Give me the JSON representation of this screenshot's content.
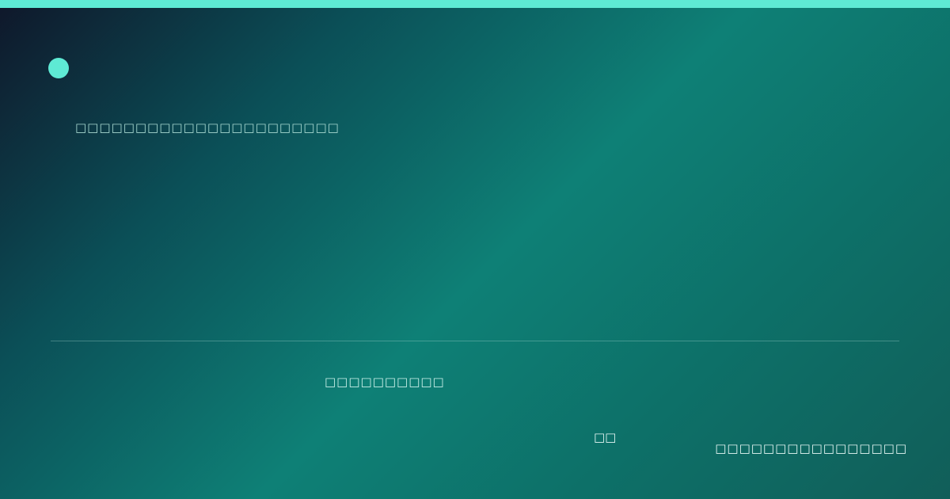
{
  "card": {
    "headline": "□□□□□□□□□□□□□□□□□□□□□□",
    "subtitle": "□□□□□□□□□□",
    "tag": "□□",
    "signature": "□□□□□□□□□□□□□□□□"
  },
  "colors": {
    "accent": "#5eead4",
    "gradient_start": "#0f172a",
    "gradient_mid": "#0e8076",
    "gradient_end": "#115e59"
  }
}
